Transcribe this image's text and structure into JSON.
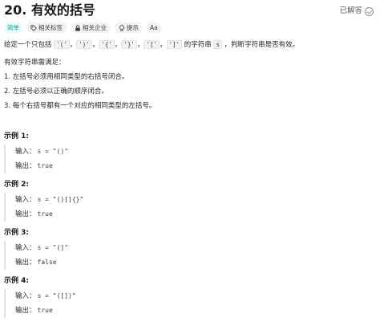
{
  "problem": {
    "title": "20. 有效的括号",
    "solved_label": "已解答"
  },
  "tags": {
    "difficulty": "简单",
    "topics": "相关标签",
    "companies": "相关企业",
    "hint": "提示",
    "font_size": "Aa"
  },
  "description": {
    "intro_before": "给定一个只包括 ",
    "chars": [
      "'('",
      "')'",
      "'{'",
      "'}'",
      "'['",
      "']'"
    ],
    "separator": "，",
    "intro_middle": " 的字符串 ",
    "var_s": "s",
    "intro_after": " ，判断字符串是否有效。",
    "condition_lead": "有效字符串需满足：",
    "rules": [
      "1. 左括号必须用相同类型的右括号闭合。",
      "2. 左括号必须以正确的顺序闭合。",
      "3. 每个右括号都有一个对应的相同类型的左括号。"
    ]
  },
  "examples": [
    {
      "title": "示例 1:",
      "input_label": "输入：",
      "input": "s = \"()\"",
      "output_label": "输出：",
      "output": "true"
    },
    {
      "title": "示例 2:",
      "input_label": "输入：",
      "input": "s = \"()[]{}\"",
      "output_label": "输出：",
      "output": "true"
    },
    {
      "title": "示例 3:",
      "input_label": "输入：",
      "input": "s = \"(]\"",
      "output_label": "输出：",
      "output": "false"
    },
    {
      "title": "示例 4:",
      "input_label": "输入：",
      "input": "s = \"([])\"",
      "output_label": "输出：",
      "output": "true"
    }
  ],
  "colors": {
    "difficulty_easy": "#00af9b",
    "text": "#262626"
  },
  "icons": {
    "topics": "tag-icon",
    "companies": "lock-icon",
    "hint": "lightbulb-icon",
    "solved": "check-circle-icon"
  }
}
